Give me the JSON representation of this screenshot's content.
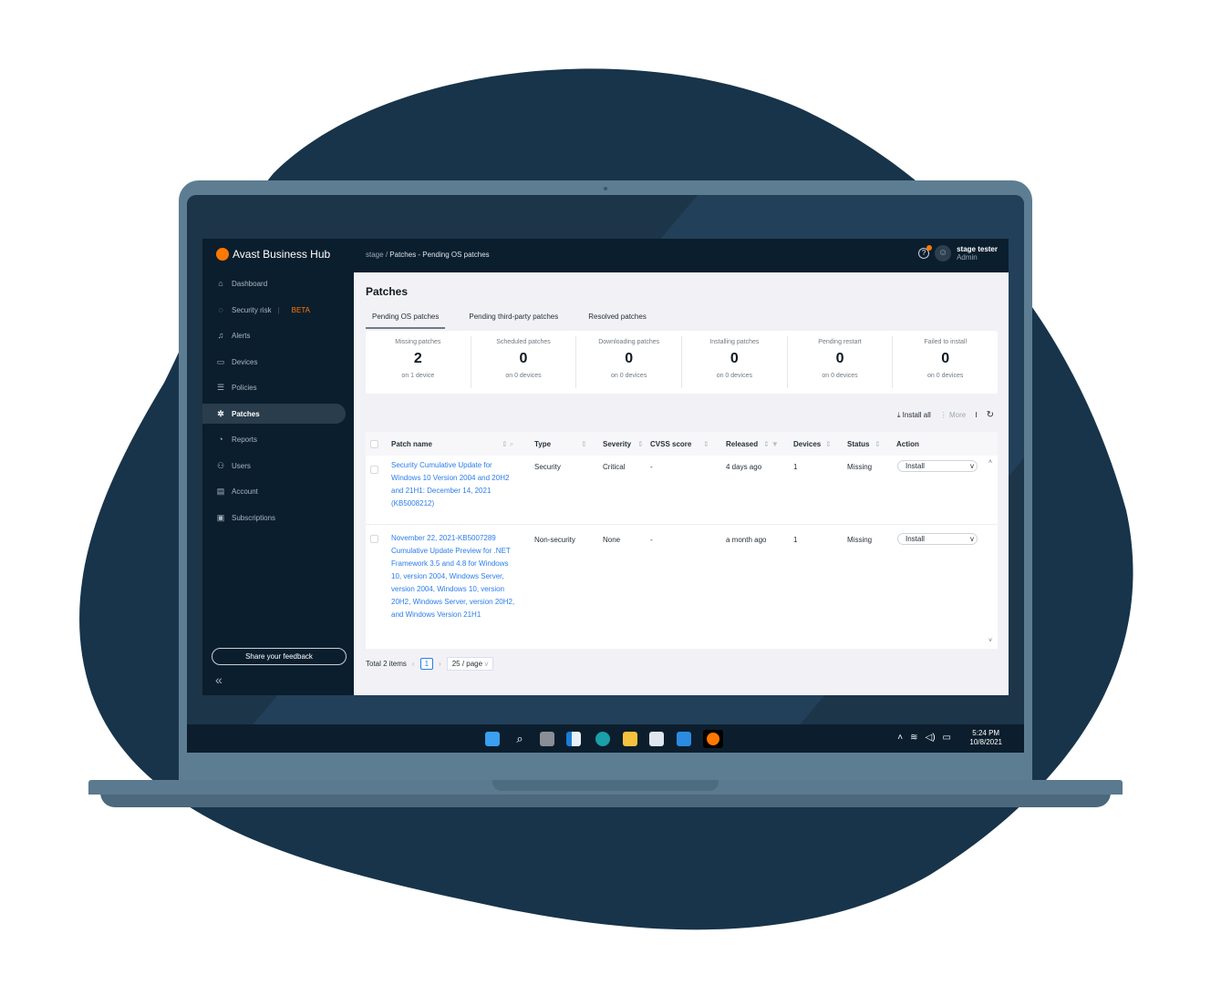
{
  "app": {
    "brand": "Avast Business Hub",
    "breadcrumb": {
      "root": "stage",
      "separator": "/",
      "current": "Patches - Pending OS patches"
    },
    "user": {
      "name": "stage tester",
      "role": "Admin"
    }
  },
  "sidebar": {
    "items": [
      {
        "label": "Dashboard",
        "icon": "home-icon"
      },
      {
        "label": "Security risk",
        "icon": "flame-icon",
        "badge": "BETA"
      },
      {
        "label": "Alerts",
        "icon": "bell-icon"
      },
      {
        "label": "Devices",
        "icon": "monitor-icon"
      },
      {
        "label": "Policies",
        "icon": "sliders-icon"
      },
      {
        "label": "Patches",
        "icon": "patches-icon",
        "active": true
      },
      {
        "label": "Reports",
        "icon": "pie-chart-icon"
      },
      {
        "label": "Users",
        "icon": "users-icon"
      },
      {
        "label": "Account",
        "icon": "document-icon"
      },
      {
        "label": "Subscriptions",
        "icon": "subscription-icon"
      }
    ],
    "feedback": "Share your feedback",
    "collapse": "«"
  },
  "main": {
    "title": "Patches",
    "tabs": [
      "Pending OS patches",
      "Pending third-party patches",
      "Resolved patches"
    ],
    "stats": [
      {
        "label": "Missing patches",
        "value": "2",
        "sub": "on 1 device"
      },
      {
        "label": "Scheduled patches",
        "value": "0",
        "sub": "on 0 devices"
      },
      {
        "label": "Downloading patches",
        "value": "0",
        "sub": "on 0 devices"
      },
      {
        "label": "Installing patches",
        "value": "0",
        "sub": "on 0 devices"
      },
      {
        "label": "Pending restart",
        "value": "0",
        "sub": "on 0 devices"
      },
      {
        "label": "Failed to install",
        "value": "0",
        "sub": "on 0 devices"
      }
    ],
    "toolbar": {
      "install_all": "Install all",
      "more": "More"
    },
    "table": {
      "columns": [
        "Patch name",
        "Type",
        "Severity",
        "CVSS score",
        "Released",
        "Devices",
        "Status",
        "Action"
      ],
      "rows": [
        {
          "name": "Security Cumulative Update for Windows 10 Version 2004 and 20H2 and 21H1: December 14, 2021 (KB5008212)",
          "type": "Security",
          "severity": "Critical",
          "cvss": "-",
          "released": "4 days ago",
          "devices": "1",
          "status": "Missing",
          "action": "Install"
        },
        {
          "name": "November 22, 2021-KB5007289 Cumulative Update Preview for .NET Framework 3.5 and 4.8 for Windows 10, version 2004, Windows Server, version 2004, Windows 10, version 20H2, Windows Server, version 20H2, and Windows Version 21H1",
          "type": "Non-security",
          "severity": "None",
          "cvss": "-",
          "released": "a month ago",
          "devices": "1",
          "status": "Missing",
          "action": "Install"
        }
      ]
    },
    "pagination": {
      "total": "Total 2 items",
      "page": "1",
      "per_page": "25 / page"
    }
  },
  "taskbar": {
    "time": "5:24 PM",
    "date": "10/8/2021"
  },
  "colors": {
    "accent": "#ff7800",
    "link": "#2b7de9",
    "sidebar": "#0b1e2d",
    "blob": "#17344b"
  }
}
